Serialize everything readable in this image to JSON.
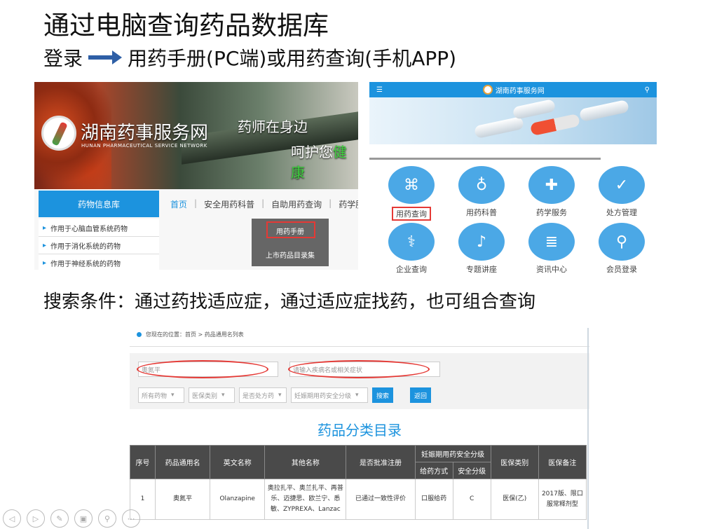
{
  "title": "通过电脑查询药品数据库",
  "subline": {
    "login": "登录",
    "rest": "用药手册(PC端)或用药查询(手机APP)"
  },
  "site": {
    "name": "湖南药事服务网",
    "name_en": "HUNAN PHARMACEUTICAL SERVICE NETWORK",
    "slogan1": "药师在身边",
    "slogan2_a": "呵护您",
    "slogan2_b": "健康",
    "left_nav": "药物信息库",
    "categories": [
      "作用于心脑血管系统药物",
      "作用于消化系统的药物",
      "作用于神经系统的药物"
    ],
    "topnav": {
      "home": "首页",
      "n1": "安全用药科普",
      "n2": "自助用药查询",
      "n3": "药学服务"
    },
    "dropdown": [
      "用药手册",
      "上市药品目录集"
    ]
  },
  "mobile": {
    "logo": "湖南药事服务网",
    "items": [
      "用药查询",
      "用药科普",
      "药学服务",
      "处方管理",
      "企业查询",
      "专题讲座",
      "资讯中心",
      "会员登录"
    ]
  },
  "search_condition": "搜索条件：通过药找适应症，通过适应症找药，也可组合查询",
  "search": {
    "breadcrumb": "您现在的位置：首页 > 药品通用名列表",
    "drug_input": "奥氮平",
    "disease_placeholder": "请输入疾病名或相关症状",
    "selects": [
      "所有药物",
      "医保类别",
      "是否处方药",
      "妊娠期用药安全分级"
    ],
    "btn_search": "搜索",
    "btn_back": "返回",
    "catalog_title": "药品分类目录"
  },
  "table": {
    "headers": [
      "序号",
      "药品通用名",
      "英文名称",
      "其他名称",
      "是否批准注册",
      "妊娠期用药安全分级",
      "医保类别",
      "医保备注"
    ],
    "sub_headers": [
      "给药方式",
      "安全分级"
    ],
    "rows": [
      {
        "no": "1",
        "name": "奥氮平",
        "en": "Olanzapine",
        "other": "奥拉扎平、奥兰扎平、再普乐、迈捷思、欧兰宁、悉敏、ZYPREXA、Lanzac",
        "approved": "已通过一致性评价",
        "route": "口服给药",
        "grade": "C",
        "insurance": "医保(乙)",
        "remark": "2017版、限口服常释剂型"
      }
    ]
  }
}
